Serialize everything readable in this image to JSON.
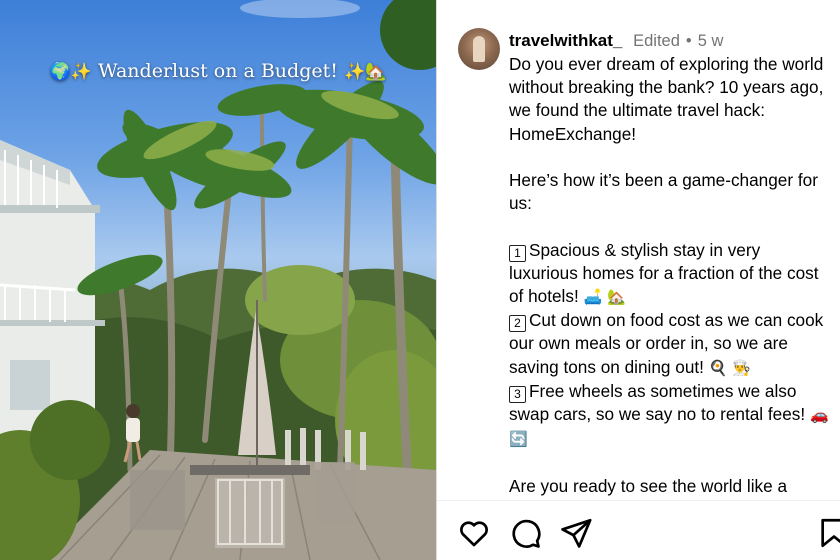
{
  "media": {
    "overlay_text": "Wanderlust on a Budget!",
    "overlay_prefix_emoji": "🌍✨",
    "overlay_suffix_emoji": "✨🏡"
  },
  "post": {
    "username": "travelwithkat_",
    "edited_label": "Edited",
    "separator": "•",
    "age": "5 w",
    "caption": {
      "intro": "Do you ever dream of exploring the world without breaking the bank? 10 years ago, we found the ultimate travel hack: HomeExchange!",
      "lead": "Here’s how it’s been a game-changer for us:",
      "items": [
        {
          "num": "1",
          "text": "Spacious & stylish stay in very luxurious homes for a fraction of the cost of hotels!",
          "emoji": "🛋️ 🏡"
        },
        {
          "num": "2",
          "text": "Cut down on food cost as we can cook our own meals or order in, so we are saving tons on dining out!",
          "emoji": "🍳 👨‍🍳"
        },
        {
          "num": "3",
          "text": "Free wheels as sometimes we also swap cars, so we say no to rental fees!",
          "emoji": "🚗 🔄"
        }
      ],
      "closing": "Are you ready to see the world like a"
    }
  },
  "actions": {
    "like": "heart-icon",
    "comment": "comment-icon",
    "share": "send-icon",
    "save": "bookmark-icon"
  },
  "colors": {
    "muted_text": "#737373",
    "divider": "#dbdbdb"
  }
}
